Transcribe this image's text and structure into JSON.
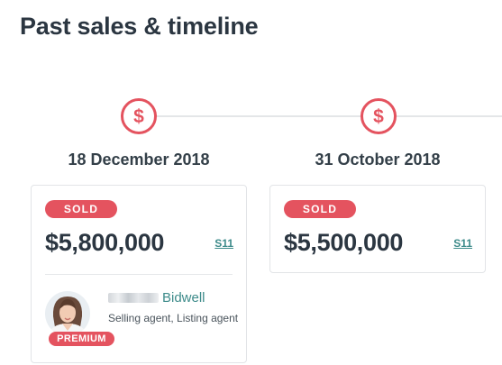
{
  "page": {
    "title": "Past sales & timeline"
  },
  "colors": {
    "accent": "#e4535f",
    "link": "#3d8b8a",
    "heading": "#2b3641"
  },
  "sales": [
    {
      "icon": "dollar-icon",
      "icon_glyph": "$",
      "date": "18 December 2018",
      "status": "SOLD",
      "price": "$5,800,000",
      "source": "S11",
      "agent": {
        "surname": "Bidwell",
        "role": "Selling agent, Listing agent",
        "tier": "PREMIUM"
      }
    },
    {
      "icon": "dollar-icon",
      "icon_glyph": "$",
      "date": "31 October 2018",
      "status": "SOLD",
      "price": "$5,500,000",
      "source": "S11"
    }
  ]
}
